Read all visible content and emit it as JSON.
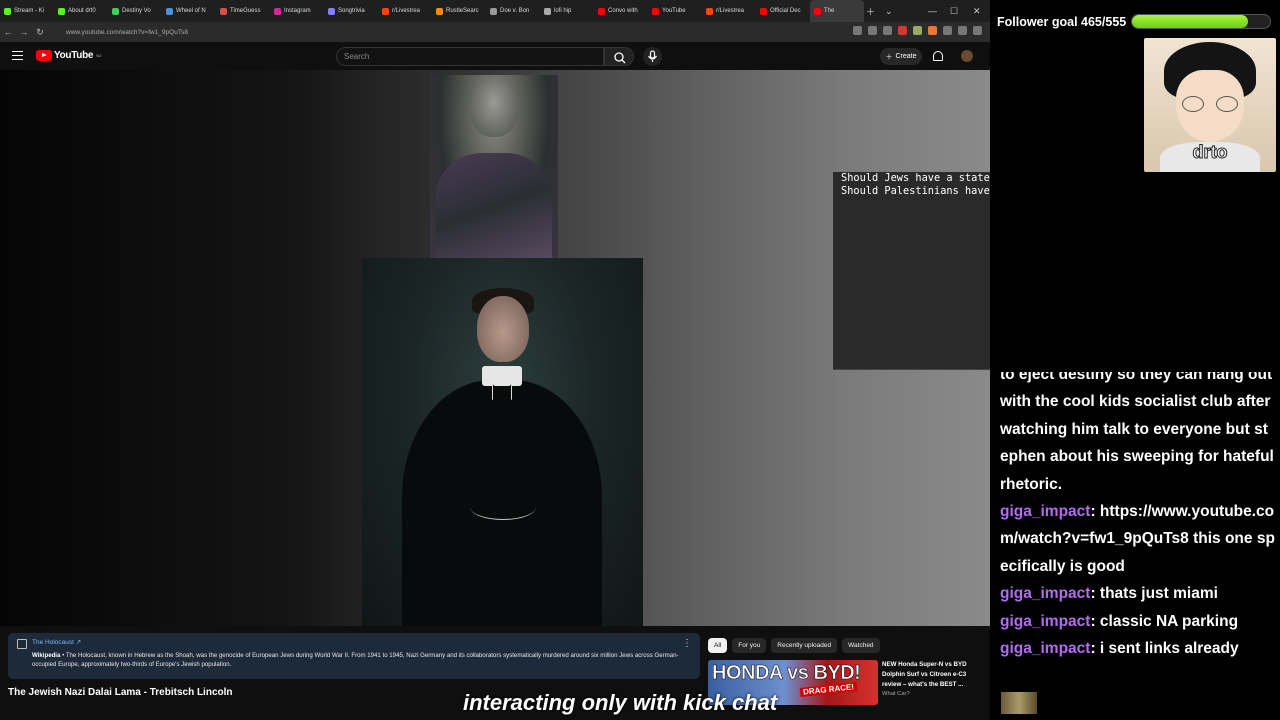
{
  "browser": {
    "tabs": [
      {
        "label": "Stream - Ki",
        "color": "#53fc18"
      },
      {
        "label": "About drt0",
        "color": "#53fc18"
      },
      {
        "label": "Destiny Vo",
        "color": "#3ecf5a"
      },
      {
        "label": "Wheel of N",
        "color": "#4a90e2"
      },
      {
        "label": "TimeGuess",
        "color": "#e24a4a"
      },
      {
        "label": "Instagram",
        "color": "#d6249f"
      },
      {
        "label": "Songtrivia",
        "color": "#8a7dff"
      },
      {
        "label": "r/Livestrea",
        "color": "#ff4500"
      },
      {
        "label": "RustleSearc",
        "color": "#ff8a00"
      },
      {
        "label": "Doe v. Bon",
        "color": "#999999"
      },
      {
        "label": "lofi hip",
        "color": "#aaaaaa"
      },
      {
        "label": "Convo with",
        "color": "#ff0000"
      },
      {
        "label": "YouTube",
        "color": "#ff0000"
      },
      {
        "label": "r/Livestrea",
        "color": "#ff4500"
      },
      {
        "label": "Official Dec",
        "color": "#ff0000"
      },
      {
        "label": "The",
        "color": "#ff0000"
      }
    ],
    "url": "www.youtube.com/watch?v=fw1_9pQuTs8"
  },
  "youtube": {
    "logo_text": "YouTube",
    "region_badge": "NZ",
    "search_placeholder": "Search",
    "create_label": "Create"
  },
  "overlay": {
    "lines": [
      "Should Jews have a state? - Pisco is ambivalent",
      "Should Palestinians have a state? - ???"
    ]
  },
  "info_card": {
    "title": "The Holocaust",
    "source": "Wikipedia",
    "text": "The Holocaust, known in Hebrew as the Shoah, was the genocide of European Jews during World War II. From 1941 to 1945, Nazi Germany and its collaborators systematically murdered around six million Jews across German-occupied Europe, approximately two-thirds of Europe's Jewish population."
  },
  "video": {
    "title": "The Jewish Nazi Dalai Lama - Trebitsch Lincoln"
  },
  "chips": [
    "All",
    "For you",
    "Recently uploaded",
    "Watched"
  ],
  "recommendation": {
    "thumb_text": "HONDA vs BYD!",
    "thumb_badge": "DRAG RACE!",
    "title": "NEW Honda Super-N vs BYD Dolphin Surf vs Citroen e-C3 review – what's the BEST ...",
    "channel": "What Car?"
  },
  "caption": "interacting only with kick chat",
  "follower_goal": {
    "label": "Follower goal 465/555",
    "current": 465,
    "target": 555
  },
  "webcam": {
    "name": "drto"
  },
  "chat": [
    {
      "user": "",
      "text": "to eject destiny so they can hang out with the cool kids socialist club after watching him talk to everyone but stephen about his sweeping for hateful rhetoric."
    },
    {
      "user": "giga_impact",
      "text": "https://www.youtube.com/watch?v=fw1_9pQuTs8 this one specifically is good"
    },
    {
      "user": "giga_impact",
      "text": "thats just miami"
    },
    {
      "user": "giga_impact",
      "text": "classic NA parking"
    },
    {
      "user": "giga_impact",
      "text": "i sent links already"
    }
  ]
}
